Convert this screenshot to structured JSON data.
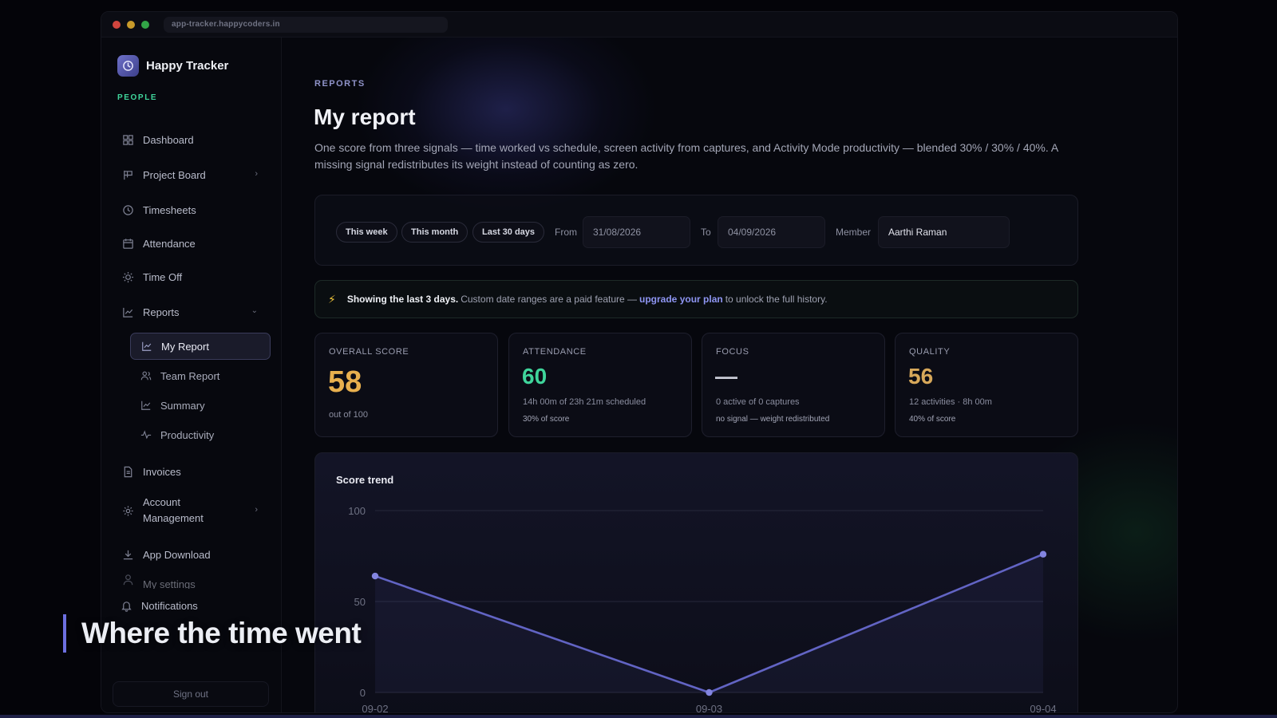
{
  "browser": {
    "url": "app-tracker.happycoders.in"
  },
  "brand": {
    "name": "Happy Tracker",
    "subtitle": "PEOPLE"
  },
  "sidebar": {
    "items": [
      {
        "label": "Dashboard",
        "icon": "grid-icon"
      },
      {
        "label": "Project Board",
        "icon": "board-icon",
        "has_chevron": true
      },
      {
        "label": "Timesheets",
        "icon": "clock-icon"
      },
      {
        "label": "Attendance",
        "icon": "calendar-icon"
      },
      {
        "label": "Time Off",
        "icon": "sun-icon"
      },
      {
        "label": "Reports",
        "icon": "chart-icon",
        "expanded": true
      },
      {
        "label": "Invoices",
        "icon": "document-icon"
      },
      {
        "label": "Account Management",
        "icon": "gear-icon",
        "has_chevron": true
      },
      {
        "label": "App Download",
        "icon": "download-icon"
      },
      {
        "label": "My settings",
        "icon": "user-icon"
      },
      {
        "label": "Notifications",
        "icon": "bell-icon"
      }
    ],
    "report_subitems": [
      {
        "label": "My Report",
        "active": true
      },
      {
        "label": "Team Report"
      },
      {
        "label": "Summary"
      },
      {
        "label": "Productivity"
      }
    ],
    "sign_out": "Sign out"
  },
  "page": {
    "eyebrow": "REPORTS",
    "title": "My report",
    "description": "One score from three signals — time worked vs schedule, screen activity from captures, and Activity Mode productivity — blended 30% / 30% / 40%. A missing signal redistributes its weight instead of counting as zero."
  },
  "filters": {
    "chips": [
      "This week",
      "This month",
      "Last 30 days"
    ],
    "from_label": "From",
    "from_value": "31/08/2026",
    "to_label": "To",
    "to_value": "04/09/2026",
    "member_label": "Member",
    "member_value": "Aarthi Raman"
  },
  "banner": {
    "strong": "Showing the last 3 days.",
    "text_before": "Custom date ranges are a paid feature —",
    "link": "upgrade your plan",
    "text_after": "to unlock the full history."
  },
  "stats": {
    "overall": {
      "label": "OVERALL SCORE",
      "value": "58",
      "sub": "out of 100"
    },
    "attendance": {
      "label": "ATTENDANCE",
      "value": "60",
      "line1": "14h 00m of 23h 21m scheduled",
      "line2": "30% of score"
    },
    "focus": {
      "label": "FOCUS",
      "value": "—",
      "line1": "0 active of 0 captures",
      "line2": "no signal — weight redistributed"
    },
    "quality": {
      "label": "QUALITY",
      "value": "56",
      "line1": "12 activities · 8h 00m",
      "line2": "40% of score"
    }
  },
  "colors": {
    "accent": "#6d6fe0",
    "overall": "#e8b04e",
    "attendance": "#3fd59b",
    "focus": "#c9cbd6",
    "quality": "#d7a85a",
    "line": "#6264c4"
  },
  "chart_data": {
    "type": "line",
    "title": "Score trend",
    "x": [
      "09-02",
      "09-03",
      "09-04"
    ],
    "series": [
      {
        "values": [
          64,
          0,
          76
        ]
      }
    ],
    "yticks": [
      0,
      50,
      100
    ],
    "ylim": [
      0,
      100
    ],
    "grid": true
  },
  "caption": "Where the time went"
}
